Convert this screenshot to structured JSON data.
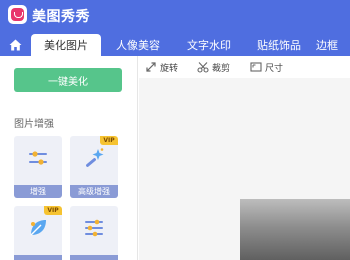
{
  "app": {
    "title": "美图秀秀"
  },
  "tabs": [
    {
      "label": "美化图片",
      "active": true
    },
    {
      "label": "人像美容",
      "active": false
    },
    {
      "label": "文字水印",
      "active": false
    },
    {
      "label": "贴纸饰品",
      "active": false
    },
    {
      "label": "边框",
      "active": false
    }
  ],
  "left_panel": {
    "beautify_button": "一键美化",
    "section_title": "图片增强",
    "tools": [
      {
        "label": "增强",
        "vip": false,
        "icon": "sliders-icon"
      },
      {
        "label": "高级增强",
        "vip": true,
        "vip_label": "VIP",
        "icon": "magic-wand-icon"
      },
      {
        "label": "",
        "vip": true,
        "vip_label": "VIP",
        "icon": "leaf-icon"
      },
      {
        "label": "",
        "vip": false,
        "icon": "adjust-bars-icon"
      }
    ]
  },
  "toolbar": {
    "rotate": "旋转",
    "crop": "裁剪",
    "size": "尺寸"
  },
  "colors": {
    "brand_blue": "#4f6ee0",
    "green_button": "#56c58b",
    "vip_gold": "#f6c331",
    "tool_label_bg": "#8a9bd6"
  }
}
